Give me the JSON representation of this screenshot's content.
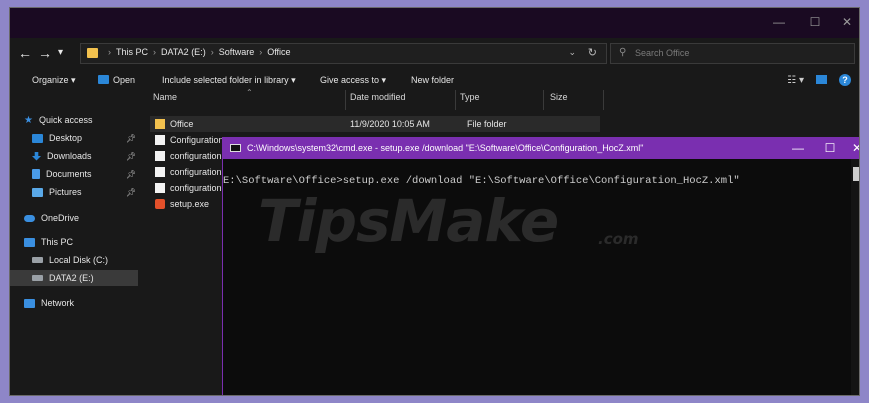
{
  "window": {
    "minimize": "—",
    "maximize": "☐",
    "close": "✕"
  },
  "nav": {
    "back": "←",
    "forward": "→",
    "recent": "▾",
    "up": "↑"
  },
  "address": {
    "crumbs": [
      "This PC",
      "DATA2 (E:)",
      "Software",
      "Office"
    ],
    "dropdown": "⌄",
    "refresh": "↻"
  },
  "search": {
    "icon": "⚲",
    "placeholder": "Search Office"
  },
  "toolbar": {
    "organize": "Organize ▾",
    "open": "Open",
    "include": "Include selected folder in library ▾",
    "give_access": "Give access to ▾",
    "new_folder": "New folder"
  },
  "columns": {
    "name": "Name",
    "date": "Date modified",
    "type": "Type",
    "size": "Size"
  },
  "sidebar": {
    "items": [
      {
        "label": "Quick access",
        "icon": "star-icon"
      },
      {
        "label": "Desktop",
        "icon": "desktop-icon",
        "pinned": true
      },
      {
        "label": "Downloads",
        "icon": "download-icon",
        "pinned": true
      },
      {
        "label": "Documents",
        "icon": "documents-icon",
        "pinned": true
      },
      {
        "label": "Pictures",
        "icon": "pictures-icon",
        "pinned": true
      },
      {
        "label": "OneDrive",
        "icon": "cloud-icon"
      },
      {
        "label": "This PC",
        "icon": "computer-icon"
      },
      {
        "label": "Local Disk (C:)",
        "icon": "drive-icon"
      },
      {
        "label": "DATA2 (E:)",
        "icon": "drive-icon",
        "selected": true
      },
      {
        "label": "Network",
        "icon": "network-icon"
      }
    ]
  },
  "files": [
    {
      "name": "Office",
      "date": "11/9/2020 10:05 AM",
      "type": "File folder",
      "icon": "folder-icon"
    },
    {
      "name": "Configuration",
      "icon": "document-icon"
    },
    {
      "name": "configuration",
      "icon": "document-icon"
    },
    {
      "name": "configuration",
      "icon": "document-icon"
    },
    {
      "name": "configuration",
      "icon": "document-icon"
    },
    {
      "name": "setup.exe",
      "icon": "office-icon"
    }
  ],
  "cmd_window": {
    "title": "C:\\Windows\\system32\\cmd.exe - setup.exe  /download \"E:\\Software\\Office\\Configuration_HocZ.xml\"",
    "minimize": "—",
    "maximize": "☐",
    "close": "✕",
    "line": "E:\\Software\\Office>setup.exe /download \"E:\\Software\\Office\\Configuration_HocZ.xml\""
  },
  "watermark": {
    "text": "TipsMake",
    "suffix": ".com"
  },
  "colors": {
    "background": "#8e86c8",
    "cmd_titlebar": "#7a2fb0",
    "folder": "#f2c14e",
    "accent": "#2b87d8"
  }
}
